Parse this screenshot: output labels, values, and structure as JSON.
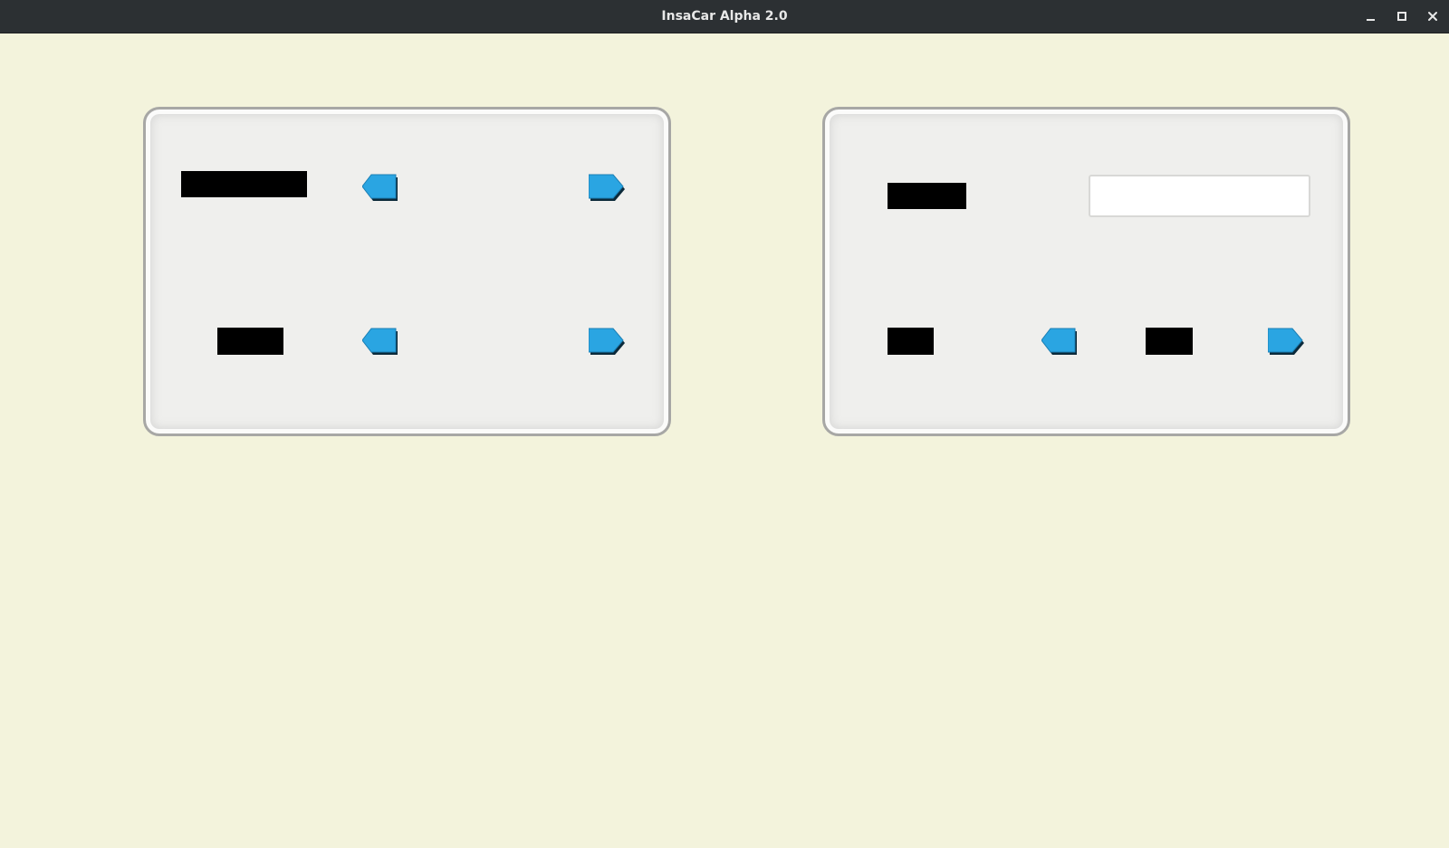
{
  "window": {
    "title": "InsaCar Alpha 2.0",
    "controls": [
      "minimize-icon",
      "maximize-icon",
      "close-icon"
    ]
  },
  "colors": {
    "background": "#f3f3dc",
    "titlebar": "#2c3033",
    "panel": "#efefed",
    "arrow_fill": "#2aa5e2",
    "arrow_shadow": "#0c2a3a"
  },
  "left_panel": {
    "row1": {
      "label": "",
      "prev_icon": "arrow-left-icon",
      "next_icon": "arrow-right-icon"
    },
    "row2": {
      "label": "",
      "prev_icon": "arrow-left-icon",
      "next_icon": "arrow-right-icon"
    }
  },
  "right_panel": {
    "row1": {
      "label": "",
      "input_value": "",
      "input_placeholder": ""
    },
    "row2": {
      "label": "",
      "value": "",
      "prev_icon": "arrow-left-icon",
      "next_icon": "arrow-right-icon"
    }
  }
}
